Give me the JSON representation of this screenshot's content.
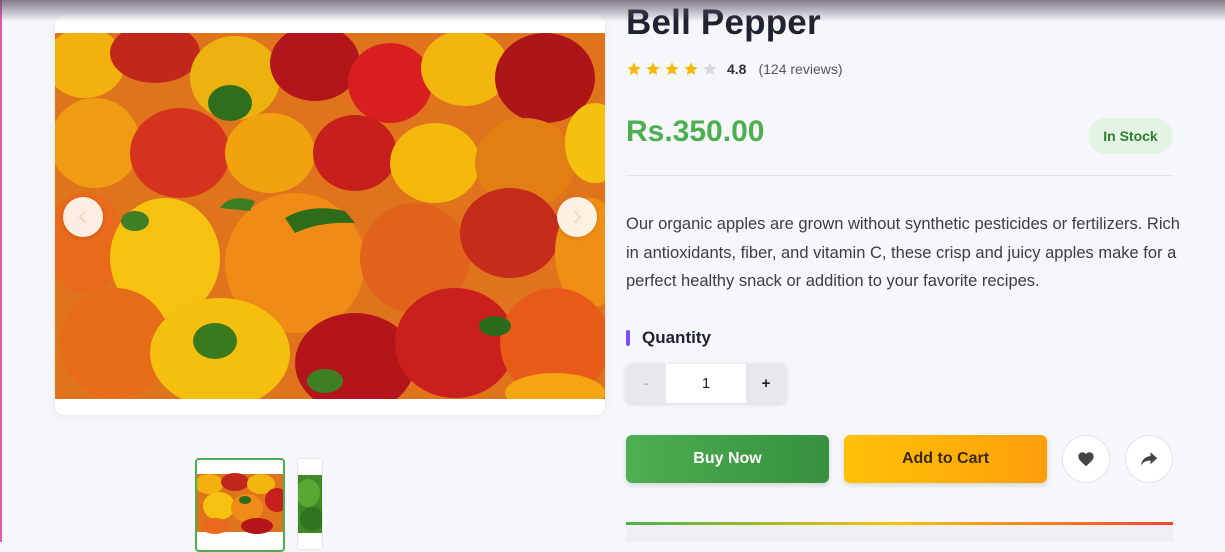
{
  "product": {
    "title": "Bell Pepper",
    "rating": {
      "value": "4.8",
      "stars_filled": 4,
      "stars_total": 5,
      "reviews": "(124 reviews)"
    },
    "price": "Rs.350.00",
    "stock_status": "In Stock",
    "description": "Our organic apples are grown without synthetic pesticides or fertilizers. Rich in antioxidants, fiber, and vitamin C, these crisp and juicy apples make for a perfect healthy snack or addition to your favorite recipes."
  },
  "gallery": {
    "prev_icon": "chevron-left-icon",
    "next_icon": "chevron-right-icon",
    "thumbnails": [
      "bell-peppers-thumbnail",
      "green-pepper-thumbnail"
    ]
  },
  "quantity": {
    "label": "Quantity",
    "decrement": "-",
    "value": "1",
    "increment": "+"
  },
  "actions": {
    "buy_now": "Buy Now",
    "add_to_cart": "Add to Cart",
    "wishlist_icon": "heart-icon",
    "share_icon": "share-icon"
  },
  "colors": {
    "accent_green": "#4caf50",
    "accent_orange": "#ffc107",
    "star": "#f5b800",
    "quantity_bar": "#7c4dff"
  }
}
